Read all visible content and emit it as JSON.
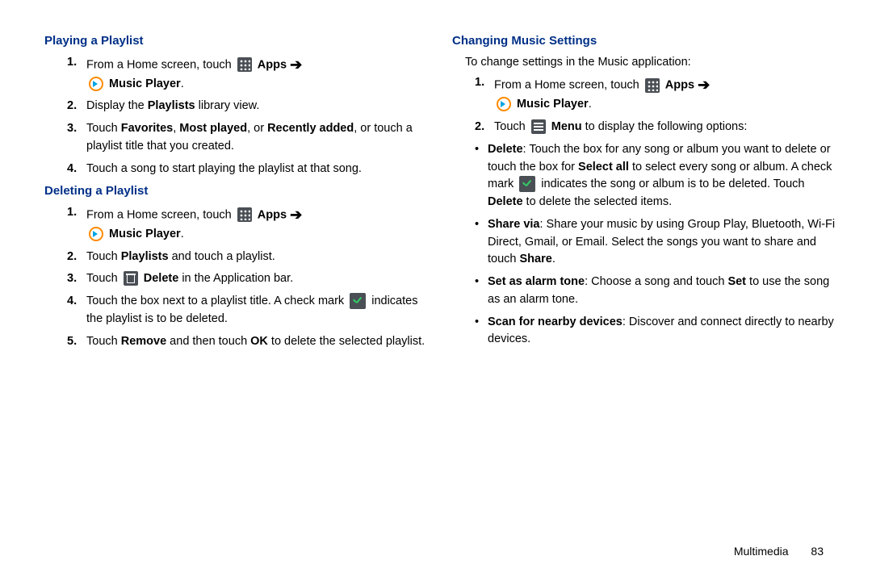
{
  "left": {
    "playing": {
      "title": "Playing a Playlist",
      "items": [
        {
          "num": "1.",
          "pre": "From a Home screen, touch ",
          "apps": "Apps",
          "post": "",
          "mp": "Music Player",
          "end": "."
        },
        {
          "num": "2.",
          "t1": "Display the ",
          "b1": "Playlists",
          "t2": " library view."
        },
        {
          "num": "3.",
          "t1": "Touch ",
          "b1": "Favorites",
          "t2": ", ",
          "b2": "Most played",
          "t3": ", or ",
          "b3": "Recently added",
          "t4": ", or touch a playlist title that you created."
        },
        {
          "num": "4.",
          "t1": "Touch a song to start playing the playlist at that song."
        }
      ]
    },
    "deleting": {
      "title": "Deleting a Playlist",
      "items": [
        {
          "num": "1.",
          "pre": "From a Home screen, touch ",
          "apps": "Apps",
          "mp": "Music Player",
          "end": "."
        },
        {
          "num": "2.",
          "t1": "Touch ",
          "b1": "Playlists",
          "t2": " and touch a playlist."
        },
        {
          "num": "3.",
          "t1": "Touch ",
          "b1": "Delete",
          "t2": " in the Application bar."
        },
        {
          "num": "4.",
          "t1": "Touch the box next to a playlist title. A check mark ",
          "t2": " indicates the playlist is to be deleted."
        },
        {
          "num": "5.",
          "t1": "Touch ",
          "b1": "Remove",
          "t2": " and then touch ",
          "b2": "OK",
          "t3": " to delete the selected playlist."
        }
      ]
    }
  },
  "right": {
    "title": "Changing Music Settings",
    "intro": "To change settings in the Music application:",
    "items": [
      {
        "num": "1.",
        "pre": "From a Home screen, touch ",
        "apps": "Apps",
        "mp": "Music Player",
        "end": "."
      },
      {
        "num": "2.",
        "t1": "Touch ",
        "b1": "Menu",
        "t2": " to display the following options:"
      }
    ],
    "bullets": [
      {
        "b": "Delete",
        "t1": ": Touch the box for any song or album you want to delete or touch the box for ",
        "b2": "Select all",
        "t2": " to select every song or album. A check mark ",
        "t3": " indicates the song or album is to be deleted. Touch ",
        "b3": "Delete",
        "t4": " to delete the selected items."
      },
      {
        "b": "Share via",
        "t1": ": Share your music by using Group Play, Bluetooth, Wi-Fi Direct, Gmail, or Email. Select the songs you want to share and touch ",
        "b2": "Share",
        "t2": "."
      },
      {
        "b": "Set as alarm tone",
        "t1": ": Choose a song and touch ",
        "b2": "Set",
        "t2": " to use the song as an alarm tone."
      },
      {
        "b": "Scan for nearby devices",
        "t1": ": Discover and connect directly to nearby devices."
      }
    ]
  },
  "footer": {
    "section": "Multimedia",
    "page": "83"
  }
}
